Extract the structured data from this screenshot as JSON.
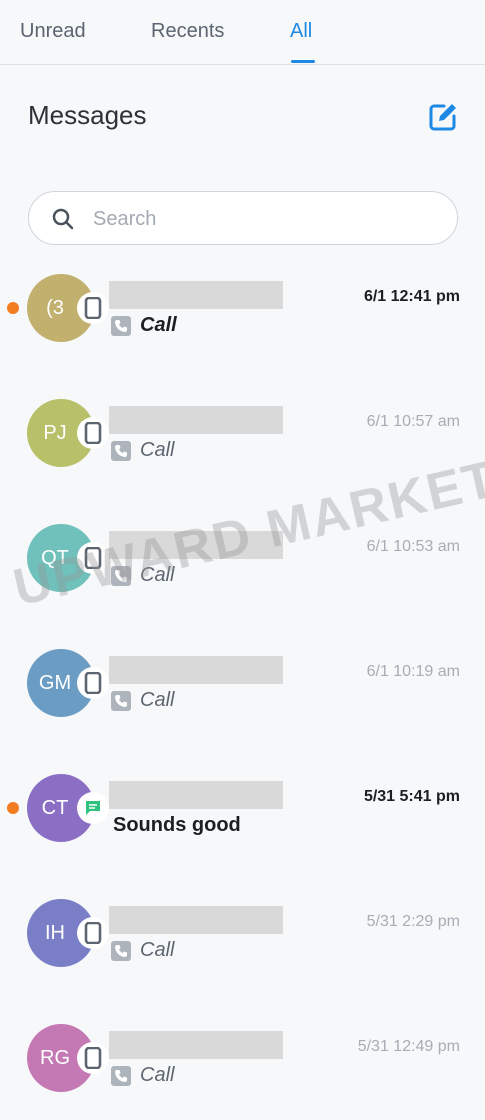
{
  "tabs": [
    {
      "label": "Unread"
    },
    {
      "label": "Recents"
    },
    {
      "label": "All"
    }
  ],
  "header": {
    "title": "Messages"
  },
  "search": {
    "placeholder": "Search"
  },
  "conversations": [
    {
      "avatar_text": "(3",
      "avatar_color": "#c2b06e",
      "badge": "phone-icon",
      "time": "6/1 12:41 pm",
      "preview": "Call",
      "unread": true,
      "preview_icon": "call-icon"
    },
    {
      "avatar_text": "PJ",
      "avatar_color": "#b8c16a",
      "badge": "phone-icon",
      "time": "6/1 10:57 am",
      "preview": "Call",
      "unread": false,
      "preview_icon": "call-icon"
    },
    {
      "avatar_text": "QT",
      "avatar_color": "#70c0bc",
      "badge": "phone-icon",
      "time": "6/1 10:53 am",
      "preview": "Call",
      "unread": false,
      "preview_icon": "call-icon"
    },
    {
      "avatar_text": "GM",
      "avatar_color": "#6b9dc4",
      "badge": "phone-icon",
      "time": "6/1 10:19 am",
      "preview": "Call",
      "unread": false,
      "preview_icon": "call-icon"
    },
    {
      "avatar_text": "CT",
      "avatar_color": "#8a6fc4",
      "badge": "chat-icon",
      "time": "5/31 5:41 pm",
      "preview": "Sounds good",
      "unread": true,
      "preview_icon": ""
    },
    {
      "avatar_text": "IH",
      "avatar_color": "#7a7ec6",
      "badge": "phone-icon",
      "time": "5/31 2:29 pm",
      "preview": "Call",
      "unread": false,
      "preview_icon": "call-icon"
    },
    {
      "avatar_text": "RG",
      "avatar_color": "#c479b4",
      "badge": "phone-icon",
      "time": "5/31 12:49 pm",
      "preview": "Call",
      "unread": false,
      "preview_icon": "call-icon"
    }
  ],
  "watermark": "UPWARD MARKETING",
  "colors": {
    "accent": "#1e88e5",
    "unread_dot": "#f47c20",
    "chat_badge": "#2ec27e"
  }
}
